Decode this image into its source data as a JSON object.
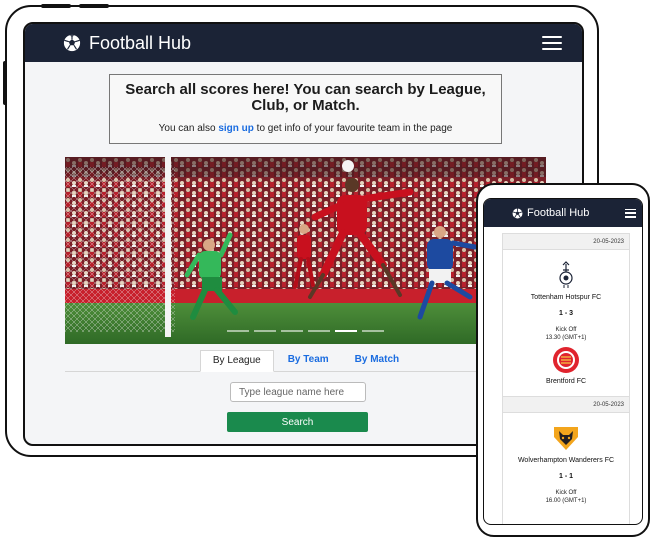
{
  "tablet": {
    "brand": "Football Hub",
    "hero_title": "Search all scores here! You can search by League, Club, or Match.",
    "hero_sub_before": "You can also ",
    "hero_link": "sign up",
    "hero_sub_after": " to get info of your favourite team in the page",
    "tabs": [
      "By League",
      "By Team",
      "By Match"
    ],
    "active_tab": "By League",
    "search_placeholder": "Type league name here",
    "search_button": "Search"
  },
  "phone": {
    "brand": "Football Hub",
    "matches": [
      {
        "date": "20-05-2023",
        "home": "Tottenham Hotspur FC",
        "score": "1 - 3",
        "kickoff_label": "Kick Off",
        "kickoff_time": "13.30 (GMT+1)",
        "away": "Brentford FC"
      },
      {
        "date": "20-05-2023",
        "home": "Wolverhampton Wanderers FC",
        "score": "1 - 1",
        "kickoff_label": "Kick Off",
        "kickoff_time": "16.00 (GMT+1)"
      }
    ]
  },
  "colors": {
    "navbar": "#1b2336",
    "link": "#1a6ce0",
    "search_button": "#1a8a4d"
  },
  "icons": {
    "brand": "soccer-ball-icon",
    "menu": "hamburger-menu-icon"
  }
}
